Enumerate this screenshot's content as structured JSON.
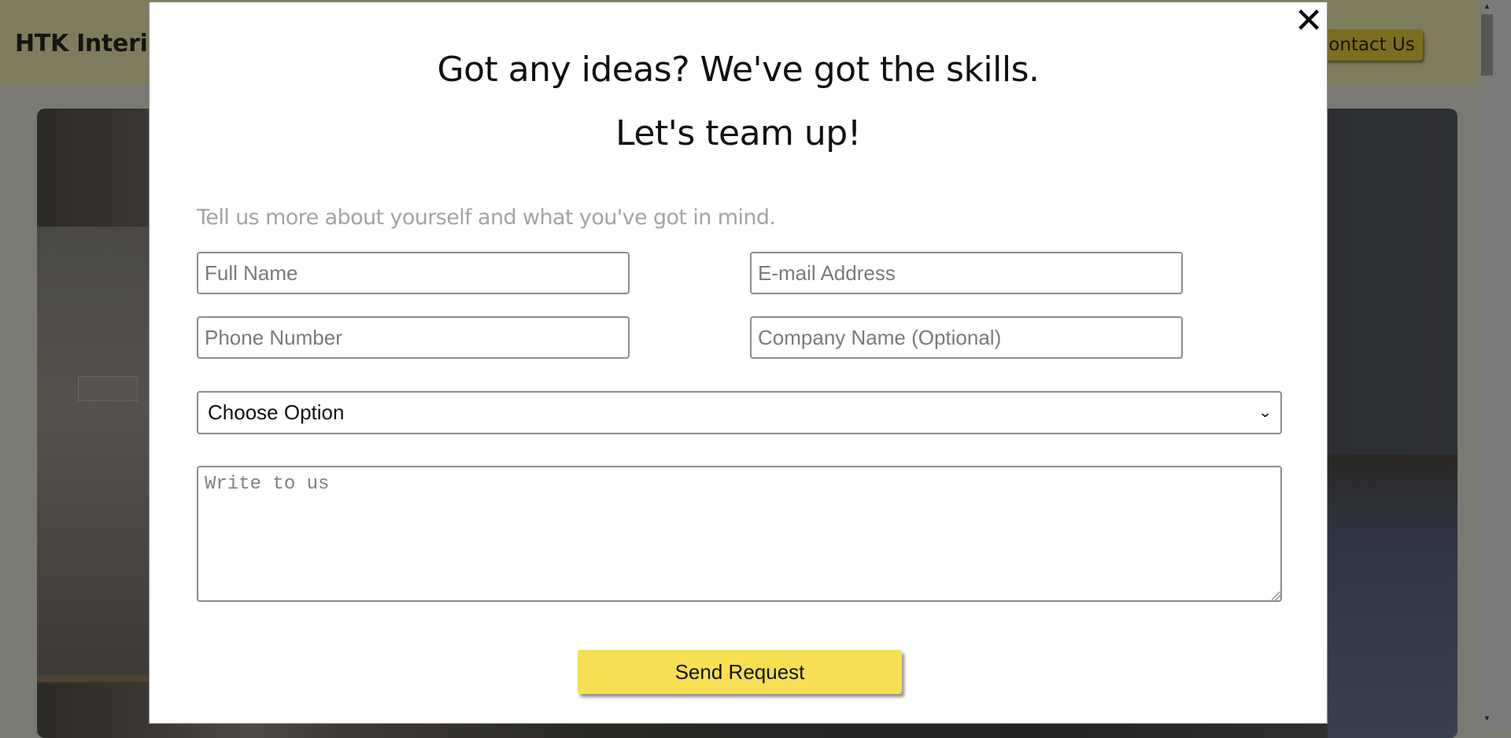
{
  "background": {
    "logo_text": "HTK Interio",
    "contact_label": "Contact Us"
  },
  "modal": {
    "close_glyph": "✕",
    "headline_1": "Got any ideas? We've got the skills.",
    "headline_2": "Let's team up!",
    "intro": "Tell us more about yourself and what you've got in mind.",
    "fields": {
      "full_name": {
        "placeholder": "Full Name",
        "value": ""
      },
      "email": {
        "placeholder": "E-mail Address",
        "value": ""
      },
      "phone": {
        "placeholder": "Phone Number",
        "value": ""
      },
      "company": {
        "placeholder": "Company Name (Optional)",
        "value": ""
      }
    },
    "select": {
      "selected": "Choose Option"
    },
    "message": {
      "placeholder": "Write to us"
    },
    "submit_label": "Send Request"
  },
  "colors": {
    "accent": "#f6df52",
    "overlay": "#7a7a72"
  },
  "scrollbar": {
    "up_icon": "▲",
    "down_icon": "▼"
  }
}
